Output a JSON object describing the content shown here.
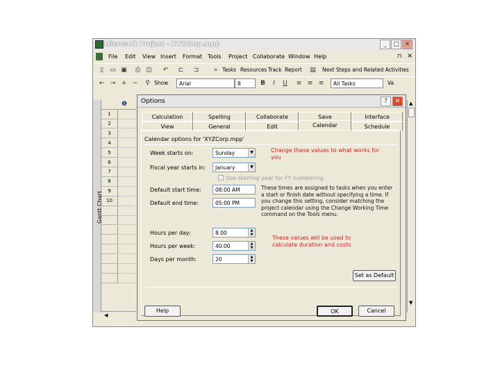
{
  "window": {
    "title": "Microsoft Project - XYZCorp.mpp",
    "min_btn": "_",
    "max_btn": "□",
    "close_btn": "✕",
    "doc_restore": "⊓",
    "doc_close": "×"
  },
  "menu": [
    "File",
    "Edit",
    "View",
    "Insert",
    "Format",
    "Tools",
    "Project",
    "Collaborate",
    "Window",
    "Help"
  ],
  "toolbar1": {
    "tasks": "Tasks",
    "resources": "Resources",
    "track": "Track",
    "report": "Report",
    "next_steps": "Next Steps and Related Activities"
  },
  "toolbar2": {
    "show": "Show",
    "font": "Arial",
    "size": "8",
    "bold": "B",
    "italic": "I",
    "underline": "U",
    "filter": "All Tasks",
    "extra": "Va"
  },
  "grid": {
    "side_label": "Gantt Chart",
    "indicator": "❶",
    "rows": [
      "1",
      "2",
      "3",
      "4",
      "5",
      "6",
      "7",
      "8",
      "9",
      "10",
      "",
      "",
      "",
      "",
      "",
      "",
      "",
      ""
    ]
  },
  "dialog": {
    "title": "Options",
    "help_btn": "?",
    "close_btn": "✕",
    "tabs_top": [
      "Calculation",
      "Spelling",
      "Collaborate",
      "Save",
      "Interface"
    ],
    "tabs_bottom": [
      "View",
      "General",
      "Edit",
      "Calendar",
      "Schedule"
    ],
    "section": "Calendar options for 'XYZCorp.mpp'",
    "week_starts_label": "Week starts on:",
    "week_starts_value": "Sunday",
    "fiscal_label": "Fiscal year starts in:",
    "fiscal_value": "January",
    "fiscal_check_label": "Use starting year for FY numbering",
    "start_time_label": "Default start time:",
    "start_time_value": "08:00 AM",
    "end_time_label": "Default end time:",
    "end_time_value": "05:00 PM",
    "hours_day_label": "Hours per day:",
    "hours_day_value": "8.00",
    "hours_week_label": "Hours per week:",
    "hours_week_value": "40.00",
    "days_month_label": "Days per month:",
    "days_month_value": "20",
    "note1": "Change these values to what works for you",
    "desc": "These times are assigned to tasks when you enter a start or finish date without specifying a time. If you change this setting, consider matching the project calendar using the Change Working Time command on the Tools menu.",
    "note2": "These values will be used to calculate duration and costs",
    "set_default": "Set as Default",
    "help": "Help",
    "ok": "OK",
    "cancel": "Cancel"
  },
  "colors": {
    "note": "#cc2222",
    "window_bg": "#ece9d8"
  }
}
